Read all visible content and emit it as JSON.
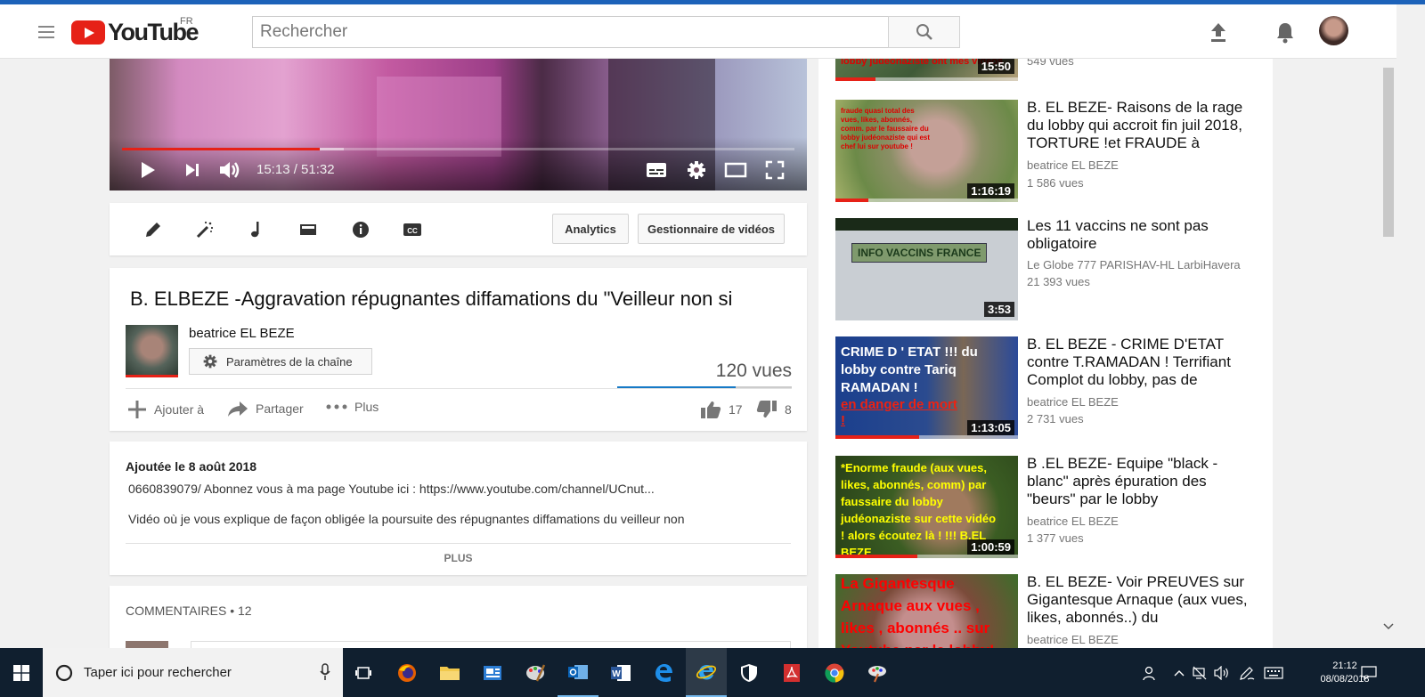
{
  "header": {
    "logo_text": "YouTube",
    "country": "FR",
    "search_placeholder": "Rechercher"
  },
  "player": {
    "time": "15:13 / 51:32",
    "progress_fraction": 0.2937,
    "buffer_fraction": 0.33
  },
  "creator_bar": {
    "analytics": "Analytics",
    "video_manager": "Gestionnaire de vidéos"
  },
  "video": {
    "title": "B. ELBEZE -Aggravation répugnantes diffamations du \"Veilleur non si",
    "channel": "beatrice EL BEZE",
    "channel_settings": "Paramètres de la chaîne",
    "views": "120 vues",
    "like_ratio": 0.68,
    "add_to": "Ajouter à",
    "share": "Partager",
    "more": "Plus",
    "likes": "17",
    "dislikes": "8"
  },
  "description": {
    "published": "Ajoutée le 8 août 2018",
    "line1": "0660839079/ Abonnez vous à ma page Youtube ici : https://www.youtube.com/channel/UCnut...",
    "line2": "Vidéo où je vous explique de façon obligée la poursuite des répugnantes diffamations du veilleur non",
    "more": "PLUS"
  },
  "comments": {
    "header": "COMMENTAIRES • 12"
  },
  "sidebar": {
    "partial": {
      "views": "549 vues",
      "duration": "15:50",
      "overlay": "lobby judéonaziste ont mes vidéos"
    },
    "items": [
      {
        "title": "B. EL BEZE- Raisons de la rage du lobby qui accroit fin juil 2018, TORTURE !et FRAUDE à",
        "channel": "beatrice EL BEZE",
        "views": "1 586 vues",
        "duration": "1:16:19",
        "watched": 0.18,
        "overlay": "fraude quasi total des vues, likes, abonnés, comm. par le faussaire du lobby judéonaziste qui est chef lui sur youtube !"
      },
      {
        "title": "Les 11 vaccins ne sont pas obligatoire",
        "channel": "Le Globe 777 PARISHAV-HL LarbiHavera",
        "views": "21 393 vues",
        "duration": "3:53",
        "watched": 0,
        "overlay": "INFO VACCINS FRANCE"
      },
      {
        "title": "B. EL BEZE - CRIME D'ETAT contre T.RAMADAN ! Terrifiant Complot du lobby, pas de",
        "channel": "beatrice EL BEZE",
        "views": "2 731 vues",
        "duration": "1:13:05",
        "watched": 0.46,
        "overlay": "CRIME D ' ETAT !!! du lobby contre Tariq RAMADAN !",
        "overlay_red": "en danger de mort !"
      },
      {
        "title": "B .EL BEZE- Equipe \"black -blanc\" après épuration des \"beurs\" par le lobby",
        "channel": "beatrice EL BEZE",
        "views": "1 377 vues",
        "duration": "1:00:59",
        "watched": 0.45,
        "overlay": "*Enorme fraude (aux vues, likes, abonnés, comm) par faussaire du lobby judéonaziste sur cette vidéo ! alors écoutez là ! !!! B.EL BEZE"
      },
      {
        "title": "B. EL BEZE- Voir PREUVES sur Gigantesque Arnaque (aux vues, likes, abonnés..) du",
        "channel": "beatrice EL BEZE",
        "views": "",
        "duration": "",
        "watched": 0,
        "overlay": "La Gigantesque Arnaque aux vues , likes , abonnés .. sur Youtube par le lobby!"
      }
    ]
  },
  "taskbar": {
    "search_text": "Taper ici pour rechercher",
    "time": "21:12",
    "date": "08/08/2018"
  }
}
